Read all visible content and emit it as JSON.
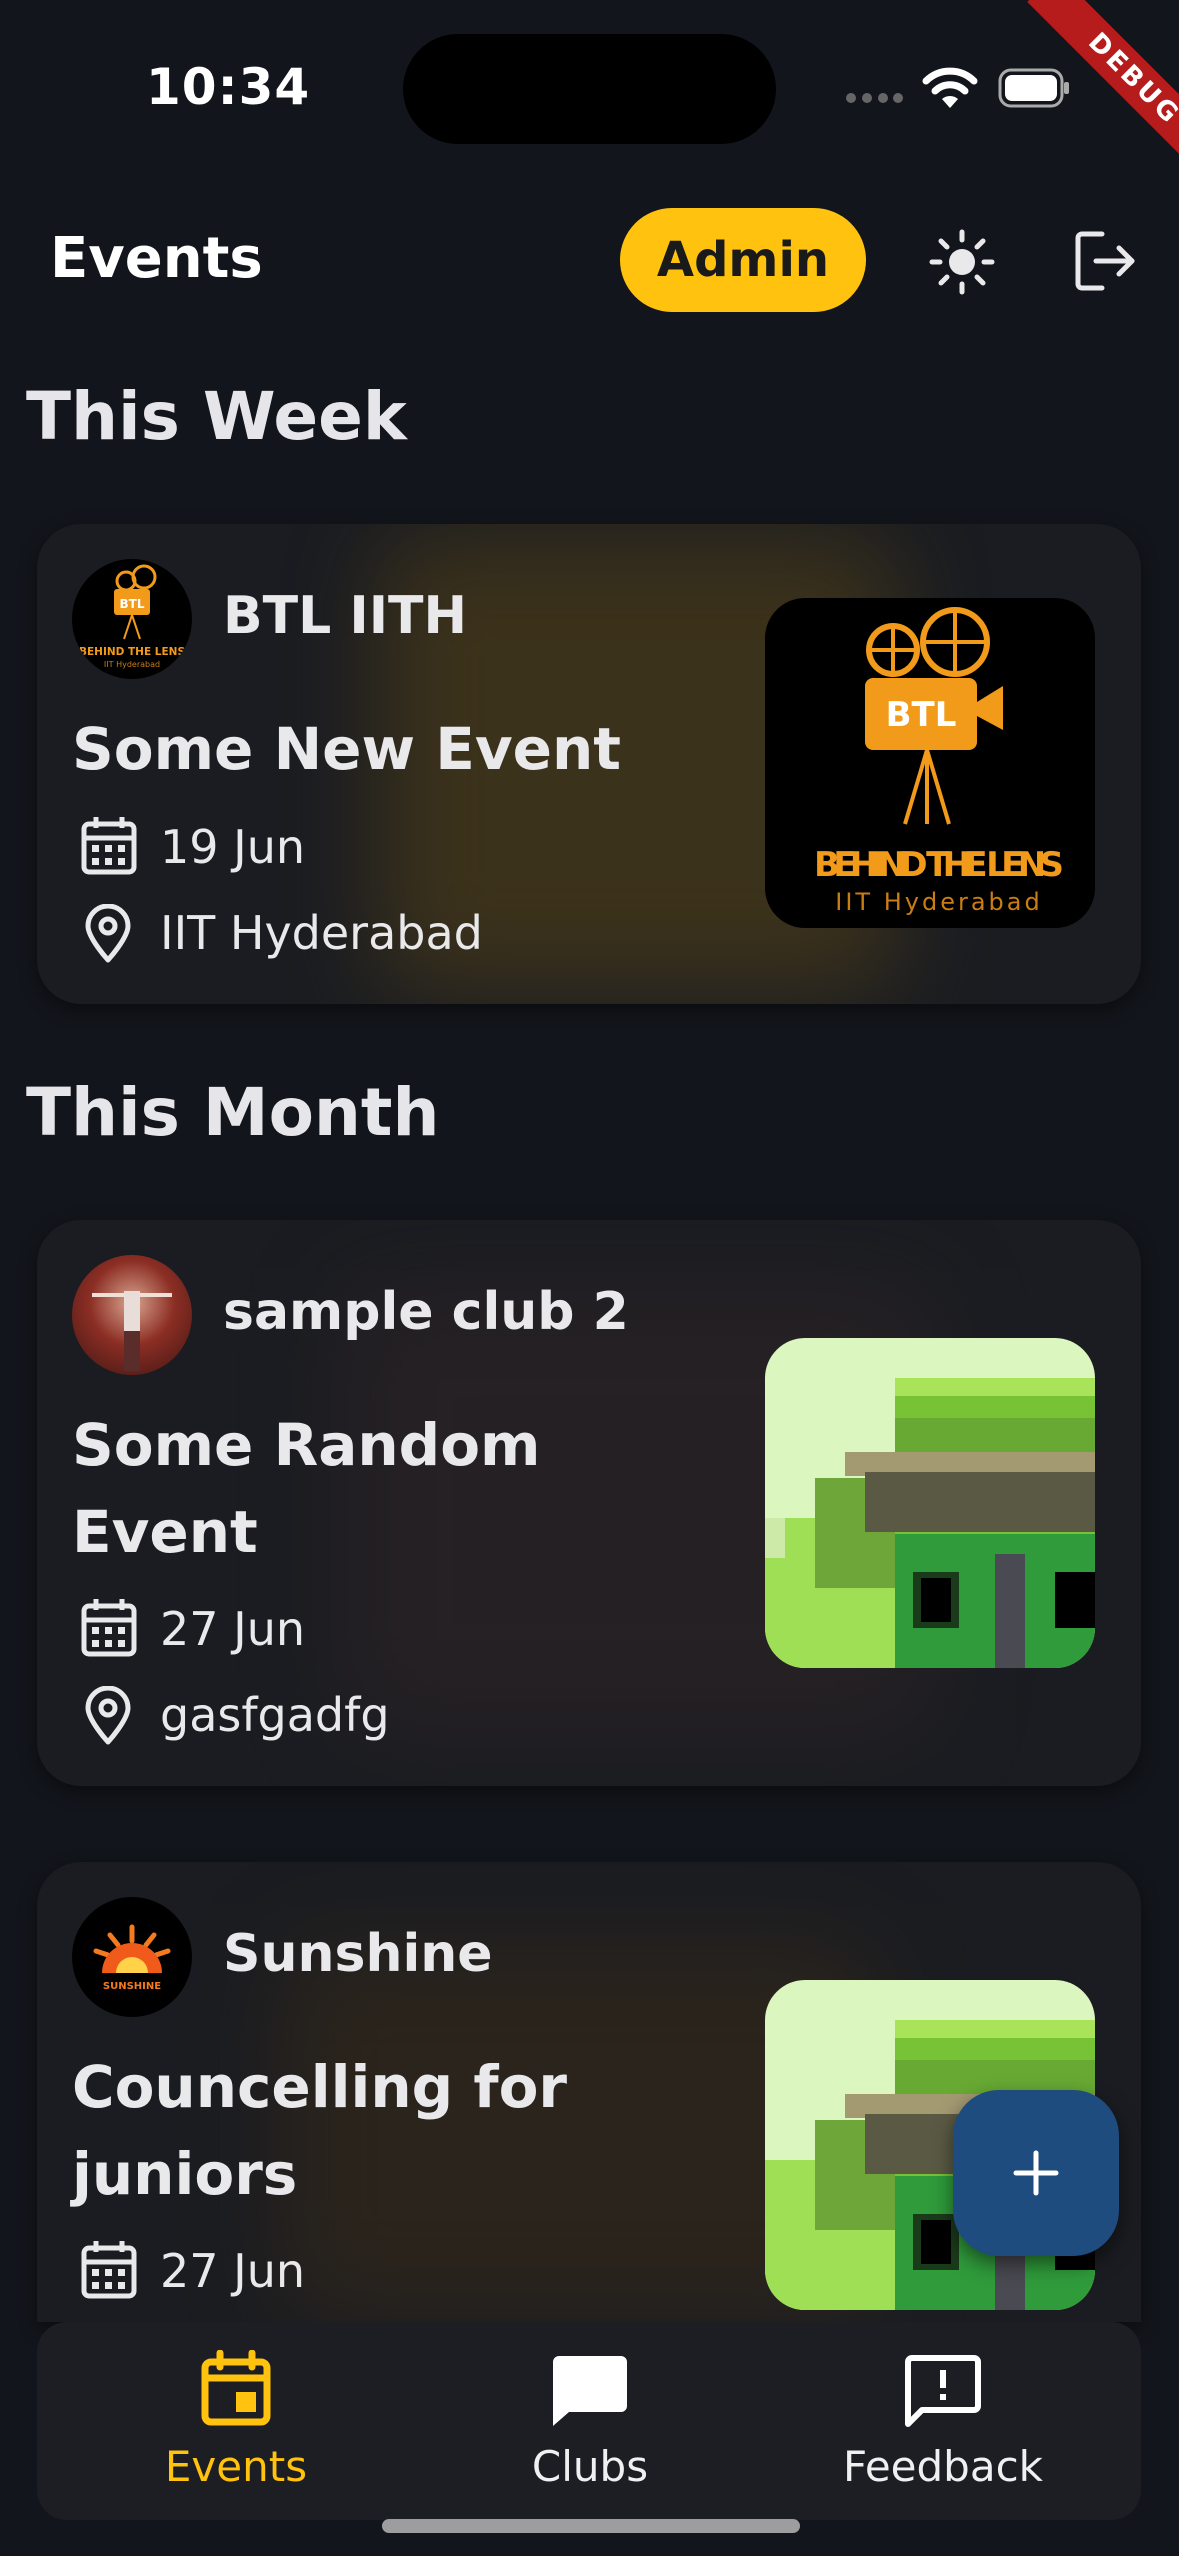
{
  "status_bar": {
    "time": "10:34"
  },
  "debug_banner": "DEBUG",
  "app_bar": {
    "title": "Events",
    "admin_label": "Admin"
  },
  "sections": {
    "this_week": "This Week",
    "this_month": "This Month"
  },
  "events": [
    {
      "club": "BTL IITH",
      "name": "Some New Event",
      "date": "19 Jun",
      "location": "IIT Hyderabad",
      "logo_text": {
        "badge": "BTL",
        "line1": "BEHIND THE LENS",
        "line2": "IIT Hyderabad"
      }
    },
    {
      "club": "sample club 2",
      "name": "Some Random Event",
      "date": "27 Jun",
      "location": "gasfgadfg"
    },
    {
      "club": "Sunshine",
      "name": "Councelling for juniors",
      "date": "27 Jun",
      "logo_text": {
        "line1": "SUNSHINE"
      }
    }
  ],
  "bottom_nav": [
    {
      "label": "Events",
      "icon": "calendar-icon",
      "active": true
    },
    {
      "label": "Clubs",
      "icon": "chat-bubble-icon",
      "active": false
    },
    {
      "label": "Feedback",
      "icon": "feedback-icon",
      "active": false
    }
  ],
  "colors": {
    "accent": "#ffc20e",
    "background": "#12151b",
    "card": "#1a1c21",
    "fab": "#1f4c7e"
  }
}
